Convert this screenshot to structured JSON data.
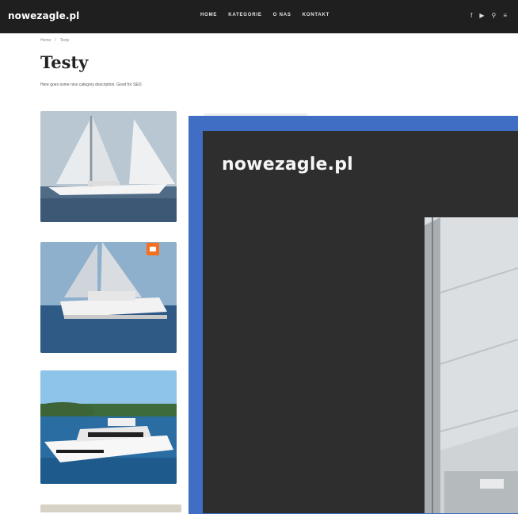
{
  "site": {
    "logo": "nowezagle.pl"
  },
  "nav": {
    "items": [
      "Home",
      "Kategorie",
      "O nas",
      "Kontakt"
    ]
  },
  "header_icons": [
    "facebook-icon",
    "youtube-icon",
    "search-icon",
    "menu-icon"
  ],
  "breadcrumb": {
    "home": "Home",
    "sep": "/",
    "current": "Testy"
  },
  "page": {
    "title": "Testy",
    "description": "Here goes some nice category description. Good for SEO."
  },
  "thumbnails": [
    {
      "icon": "sailboat-photo"
    },
    {
      "icon": "catamaran-photo",
      "badge": "video-icon"
    },
    {
      "icon": "motor-yacht-photo"
    },
    {
      "icon": "yacht-photo"
    }
  ],
  "overlay": {
    "logo": "nowezagle.pl",
    "photo": "catamaran-sail-photo"
  },
  "colors": {
    "topbar": "#1f1f1f",
    "overlay_bg": "#2e2e2e",
    "overlay_border": "#3f6ec4",
    "badge": "#f37021"
  }
}
